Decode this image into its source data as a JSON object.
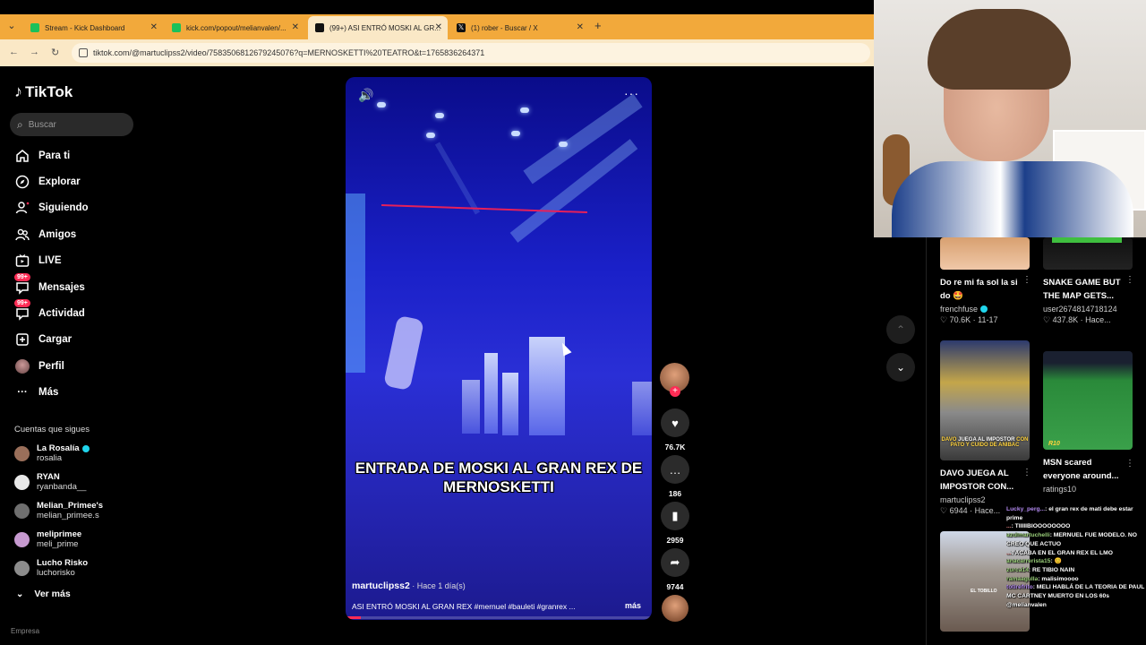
{
  "browser": {
    "tabs": [
      {
        "label": "Stream - Kick Dashboard",
        "icon": "kick-icon"
      },
      {
        "label": "kick.com/popout/melianvalen/...",
        "icon": "kick-icon"
      },
      {
        "label": "(99+) ASI ENTRÓ MOSKI AL GR...",
        "icon": "tiktok-icon",
        "active": true
      },
      {
        "label": "(1) rober - Buscar / X",
        "icon": "x-icon"
      }
    ],
    "url": "tiktok.com/@martuclipss2/video/7583506812679245076?q=MERNOSKETTI%20TEATRO&t=1765836264371"
  },
  "sidebar": {
    "logo": "TikTok",
    "search_placeholder": "Buscar",
    "nav": [
      {
        "label": "Para ti",
        "icon": "home-icon"
      },
      {
        "label": "Explorar",
        "icon": "compass-icon"
      },
      {
        "label": "Siguiendo",
        "icon": "following-icon"
      },
      {
        "label": "Amigos",
        "icon": "friends-icon"
      },
      {
        "label": "LIVE",
        "icon": "live-icon"
      },
      {
        "label": "Mensajes",
        "icon": "messages-icon",
        "badge": "99+"
      },
      {
        "label": "Actividad",
        "icon": "activity-icon",
        "badge": "99+"
      },
      {
        "label": "Cargar",
        "icon": "upload-icon"
      },
      {
        "label": "Perfil",
        "icon": "profile-icon"
      },
      {
        "label": "Más",
        "icon": "more-icon"
      }
    ],
    "following_title": "Cuentas que sigues",
    "following": [
      {
        "name": "La Rosalía",
        "handle": "rosalia",
        "verified": true,
        "color": "#9a6f5a"
      },
      {
        "name": "RYAN",
        "handle": "ryanbanda__",
        "verified": false,
        "color": "#e8e8e8"
      },
      {
        "name": "Melian_Primee's",
        "handle": "melian_primee.s",
        "verified": false,
        "color": "#6f6f6f"
      },
      {
        "name": "meliprimee",
        "handle": "meli_prime",
        "verified": false,
        "color": "#c79ad0"
      },
      {
        "name": "Lucho Risko",
        "handle": "luchorisko",
        "verified": false,
        "color": "#8c8c8c"
      }
    ],
    "see_more": "Ver más",
    "bottom_cut": "Empresa"
  },
  "video": {
    "caption": "ENTRADA DE MOSKI AL GRAN REX DE MERNOSKETTI",
    "author": "martuclipss2",
    "time": " · Hace 1 día(s)",
    "description": "ASI ENTRÓ MOSKI AL GRAN REX #mernuel #bauleti #granrex ...",
    "more": "más",
    "progress": 0.05
  },
  "actions": {
    "likes": "76.7K",
    "comments": "186",
    "saves": "2959",
    "shares": "9744"
  },
  "related": [
    {
      "title": "Do re mi fa sol la si do 🤩",
      "user": "frenchfuse",
      "verified": true,
      "likes": "70.6K",
      "date": "11-17"
    },
    {
      "title": "SNAKE GAME BUT THE MAP GETS...",
      "user": "user2674814718124",
      "verified": false,
      "likes": "437.8K",
      "date": "Hace..."
    },
    {
      "title": "DAVO JUEGA AL IMPOSTOR CON...",
      "user": "martuclipss2",
      "verified": false,
      "likes": "6944",
      "date": "Hace...",
      "thumb_text_a": "DAVO ",
      "thumb_text_b": "JUEGA AL IMPOSTOR",
      "thumb_text_c": " CON",
      "thumb_text_d": "PATO Y CUIDO DE ANIBAC"
    },
    {
      "title": "MSN scared everyone around...",
      "user": "ratings10",
      "verified": false,
      "likes": "",
      "date": "",
      "thumb_corner": "R10"
    }
  ],
  "thumb_text": {
    "tobillo": "EL TOBILLO"
  },
  "chat": [
    {
      "user": "Lucky_perg...",
      "text": ": el gran rex de mati debe estar prime",
      "cls": "u2"
    },
    {
      "user": "...",
      "text": ": TIIIIIBIOOOOOOOO",
      "cls": "u3"
    },
    {
      "user": "azulmartuchelli",
      "text": ": MERNUEL FUE MODELO. NO CREO QUE ACTUO",
      "cls": "u"
    },
    {
      "user": "...",
      "text": ": ACABA EN EL GRAN REX EL LMO",
      "cls": "u3"
    },
    {
      "user": "anacarrerista15",
      "text": ": 😊",
      "cls": "u"
    },
    {
      "user": "zurca14",
      "text": ": RE TIBIO NAIN",
      "cls": "u"
    },
    {
      "user": "ramaagulla",
      "text": ": malisimoooo",
      "cls": "u"
    },
    {
      "user": "totirefrito",
      "text": ": MELI HABLÁ DE LA TEORIA DE PAUL MC CARTNEY MUERTO EN LOS 60s @melianvalen",
      "cls": "u2"
    }
  ]
}
